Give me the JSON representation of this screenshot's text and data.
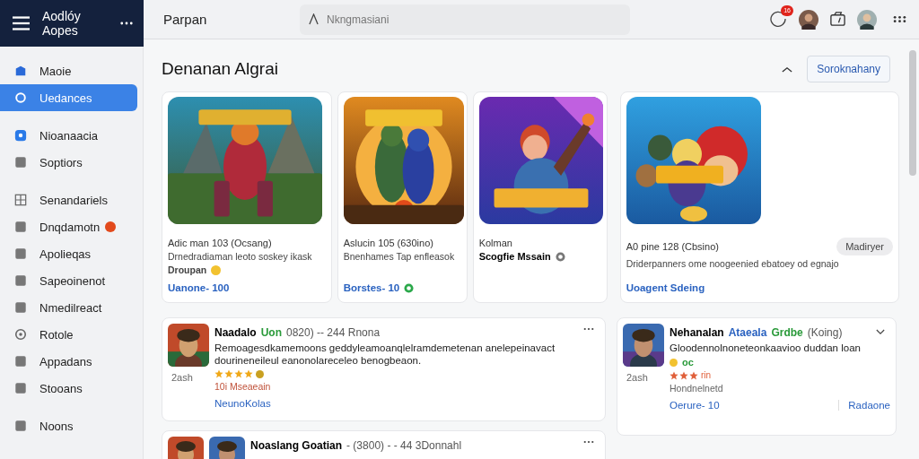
{
  "brand": {
    "line_1": "Aodlóy",
    "line_2": "Aopes"
  },
  "topbar": {
    "title": "Parpan",
    "search": {
      "placeholder": "Nkngmasiani"
    },
    "notification_badge": "16"
  },
  "sidebar": {
    "items": [
      {
        "label": "Maoie",
        "selected": false,
        "badge": false
      },
      {
        "label": "Uedances",
        "selected": true,
        "badge": false
      },
      {
        "label": "Nioanaacia",
        "selected": false,
        "badge": false
      },
      {
        "label": "Soptiors",
        "selected": false,
        "badge": false
      },
      {
        "label": "Senandariels",
        "selected": false,
        "badge": false
      },
      {
        "label": "Dnqdamotn",
        "selected": false,
        "badge": true
      },
      {
        "label": "Apolieqas",
        "selected": false,
        "badge": false
      },
      {
        "label": "Sapeoinenot",
        "selected": false,
        "badge": false
      },
      {
        "label": "Nmedilreact",
        "selected": false,
        "badge": false
      },
      {
        "label": "Rotole",
        "selected": false,
        "badge": false
      },
      {
        "label": "Appadans",
        "selected": false,
        "badge": false
      },
      {
        "label": "Stooans",
        "selected": false,
        "badge": false
      },
      {
        "label": "Noons",
        "selected": false,
        "badge": false
      }
    ]
  },
  "section": {
    "title": "Denanan Algrai",
    "button": "Soroknahany"
  },
  "featured": [
    {
      "kind": "picture",
      "title": "Adic man 103 (Ocsang)",
      "description": "Drnedradiaman leoto soskey ikask",
      "note": "Droupan",
      "link": "Uanone- 100"
    },
    {
      "kind": "picture",
      "title": "Aslucin 105 (630ino)",
      "description": "Bnenhames Tap enfleasok",
      "link": "Borstes- 10"
    },
    {
      "kind": "picture",
      "title": "Kolman",
      "subtitle": "Scogfie Mssain"
    },
    {
      "kind": "picture",
      "title": "A0 pine 128 (Cbsino)",
      "chip": "Madiryer",
      "description": "Driderpanners ome noogeenied ebatoey od egnajo",
      "link": "Uoagent Sdeing"
    }
  ],
  "reviews": [
    {
      "name": "Naadalo",
      "tag": "Uon",
      "meta": "0820) -- 244 Rnona",
      "text": "Remoagesdkamemoons geddyleamoanqlelramdemetenan anelepeinavact dourineneileul eanonolareceleo benogbeaon.",
      "stars": 4,
      "color": "#f0a818",
      "count": "2ash",
      "status": "10i Mseaeain",
      "link": "NeunoKolas"
    },
    {
      "name": "Nehanalan",
      "tag": "Ataeala",
      "tag_2": "Grdbe",
      "meta": "(Koing)",
      "text": "Gloodennolnoneteonkaavioo duddan loan",
      "badge": "oc",
      "stars": 3,
      "color": "#e0603a",
      "star_text": "rin",
      "count": "2ash",
      "status": "Hondnelnetd",
      "link": "Oerure- 10",
      "action": "Radaone"
    },
    {
      "name": "Noaslang Goatian",
      "meta": "- (3800) - - 44 3Donnahl"
    }
  ]
}
